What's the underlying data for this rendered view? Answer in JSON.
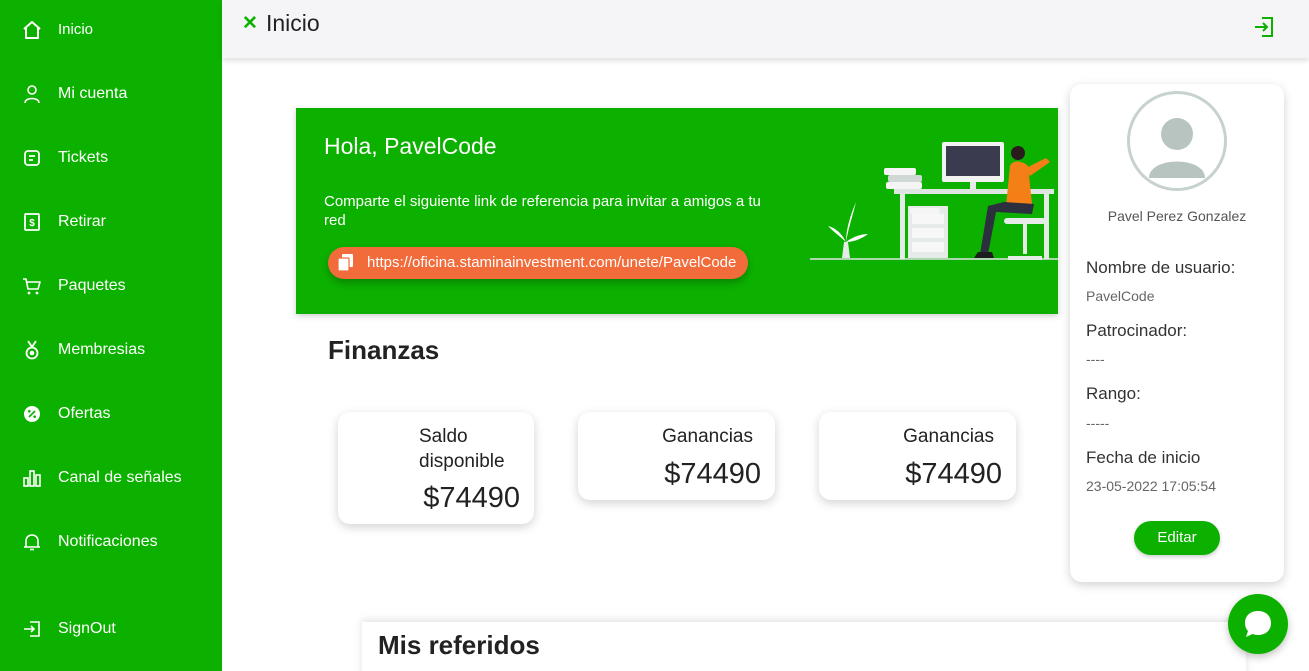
{
  "sidebar": {
    "items": [
      {
        "label": "Inicio",
        "icon": "home-icon"
      },
      {
        "label": "Mi cuenta",
        "icon": "user-icon"
      },
      {
        "label": "Tickets",
        "icon": "ticket-icon"
      },
      {
        "label": "Retirar",
        "icon": "withdraw-icon"
      },
      {
        "label": "Paquetes",
        "icon": "cart-icon"
      },
      {
        "label": "Membresias",
        "icon": "medal-icon"
      },
      {
        "label": "Ofertas",
        "icon": "discount-icon"
      },
      {
        "label": "Canal de señales",
        "icon": "bar-chart-icon"
      },
      {
        "label": "Notificaciones",
        "icon": "bell-icon"
      },
      {
        "label": "SignOut",
        "icon": "signout-icon"
      }
    ]
  },
  "header": {
    "title": "Inicio",
    "close_icon": "close-icon",
    "logout_icon": "logout-icon"
  },
  "banner": {
    "greeting": "Hola, PavelCode",
    "share_text": "Comparte el siguiente link de referencia para invitar a amigos a tu red",
    "referral_link": "https://oficina.staminainvestment.com/unete/PavelCode"
  },
  "finanzas": {
    "title": "Finanzas",
    "cards": [
      {
        "label": "Saldo disponible",
        "value": "$74490"
      },
      {
        "label": "Ganancias",
        "value": "$74490"
      },
      {
        "label": "Ganancias",
        "value": "$74490"
      }
    ]
  },
  "profile": {
    "name": "Pavel Perez Gonzalez",
    "fields": [
      {
        "label": "Nombre de usuario:",
        "value": "PavelCode"
      },
      {
        "label": "Patrocinador:",
        "value": "----"
      },
      {
        "label": "Rango:",
        "value": "-----"
      },
      {
        "label": "Fecha de inicio",
        "value": "23-05-2022 17:05:54"
      }
    ],
    "edit_label": "Editar"
  },
  "referidos": {
    "title": "Mis referidos"
  },
  "colors": {
    "brand": "#0cb100",
    "accent": "#f26b3a"
  }
}
